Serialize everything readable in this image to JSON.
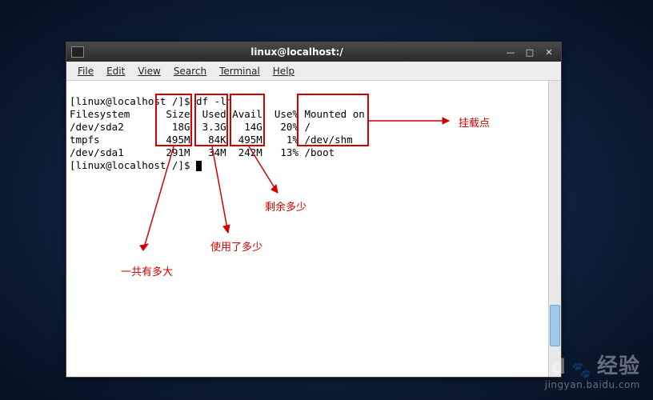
{
  "titlebar": {
    "title": "linux@localhost:/"
  },
  "menubar": {
    "file": "File",
    "edit": "Edit",
    "view": "View",
    "search": "Search",
    "terminal": "Terminal",
    "help": "Help"
  },
  "terminal": {
    "prompt1": "[linux@localhost /]$ df -lh",
    "header": "Filesystem      Size  Used Avail  Use% Mounted on",
    "row1": "/dev/sda2        18G  3.3G   14G   20% /",
    "row2": "tmpfs           495M   84K  495M    1% /dev/shm",
    "row3": "/dev/sda1       291M   34M  242M   13% /boot",
    "prompt2": "[linux@localhost /]$ "
  },
  "annotations": {
    "size": "一共有多大",
    "used": "使用了多少",
    "avail": "剩余多少",
    "mount": "挂载点"
  },
  "watermark": {
    "brand": "Baid",
    "suffix": "经验",
    "url": "jingyan.baidu.com"
  }
}
